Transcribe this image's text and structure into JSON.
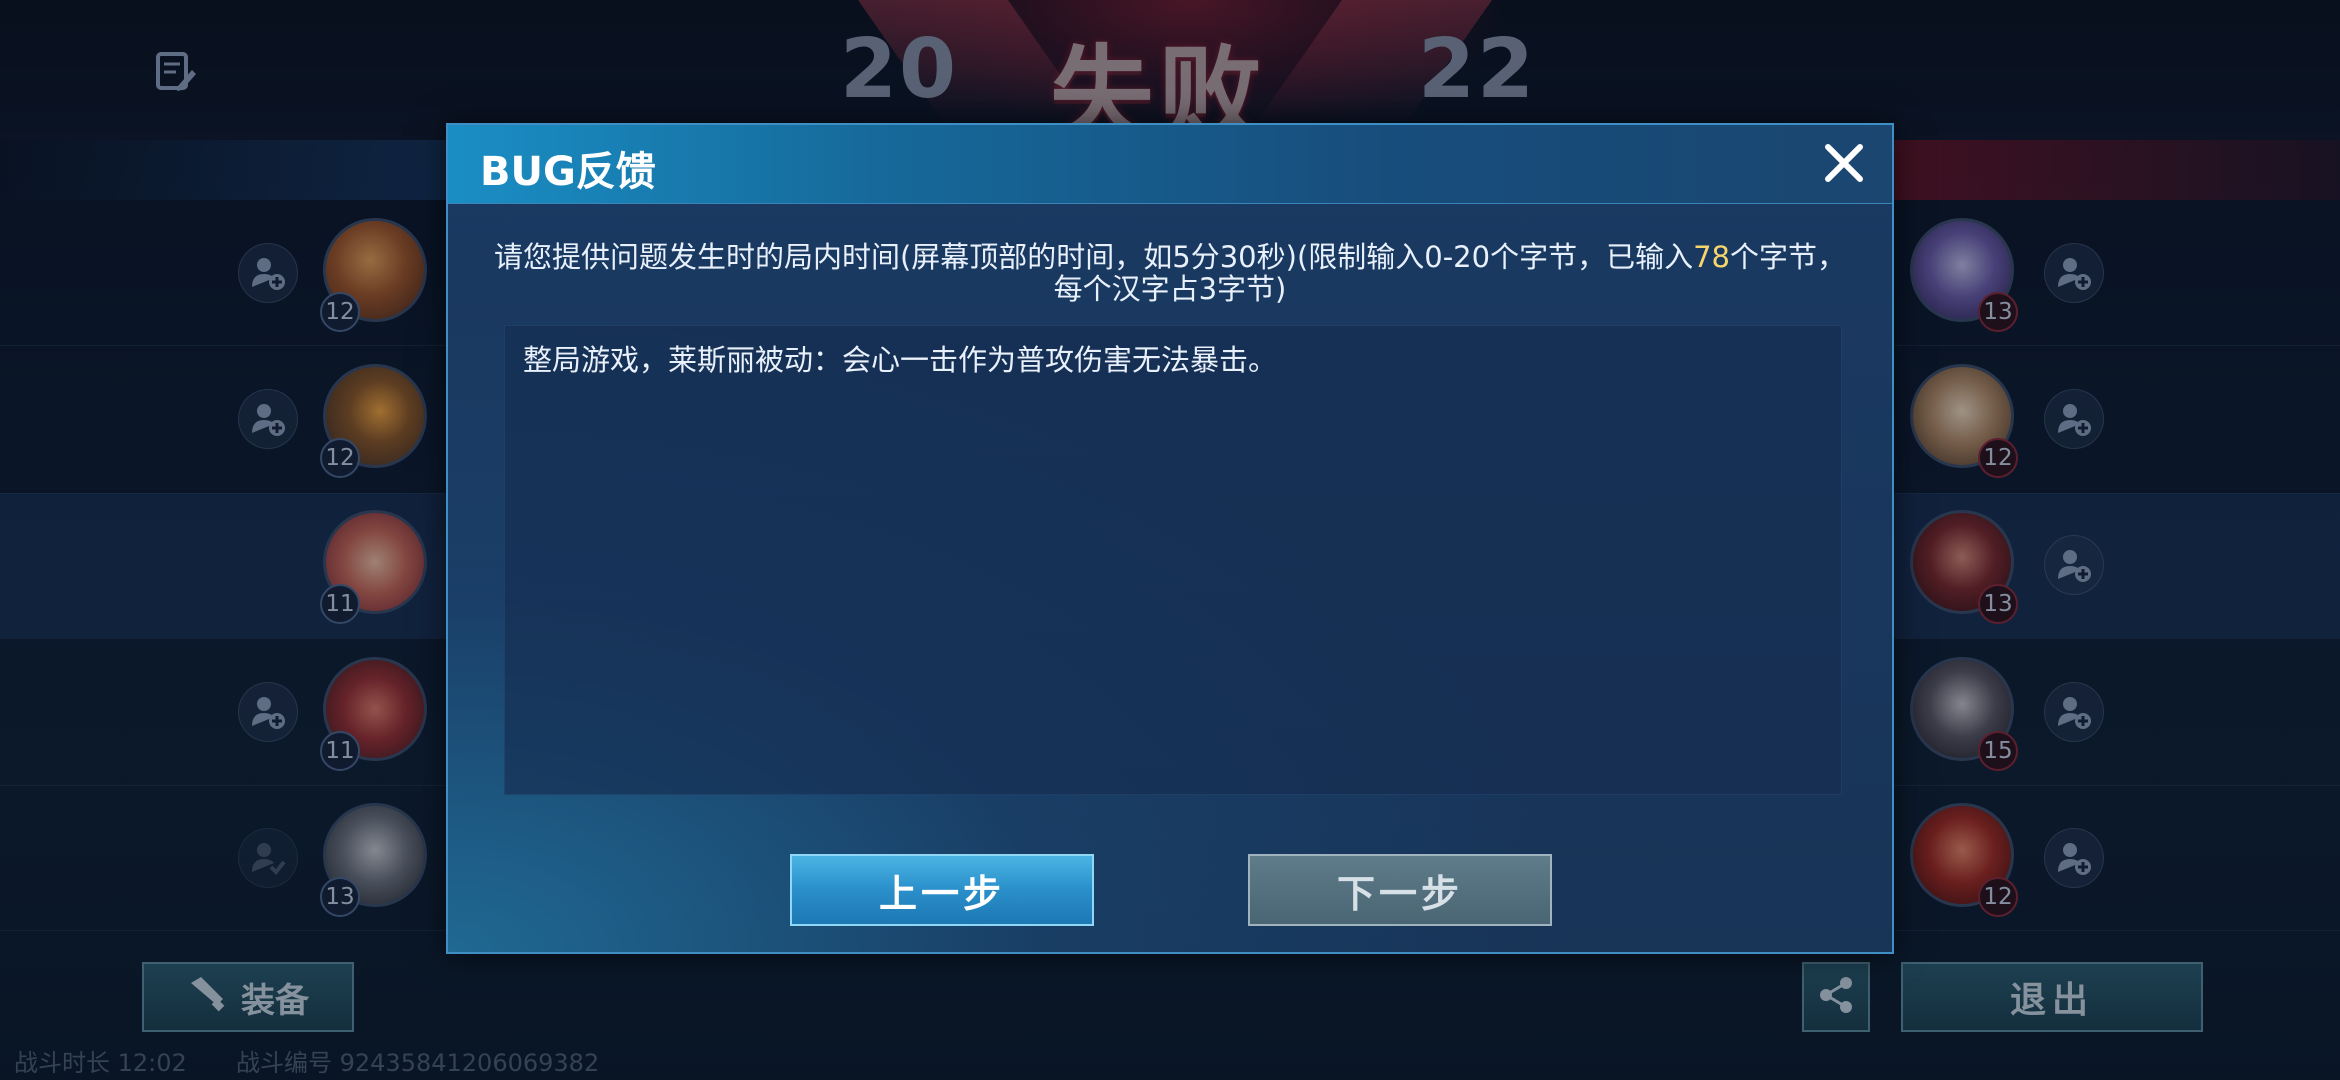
{
  "scoreboard": {
    "result_title": "失败",
    "score_left": "20",
    "score_right": "22"
  },
  "left_team": [
    {
      "hero": "hero-avatar-1",
      "level": "12"
    },
    {
      "hero": "hero-avatar-2",
      "level": "12"
    },
    {
      "hero": "hero-avatar-3",
      "level": "11"
    },
    {
      "hero": "hero-avatar-4",
      "level": "11"
    },
    {
      "hero": "hero-avatar-5",
      "level": "13"
    }
  ],
  "right_team": [
    {
      "hero": "hero-avatar-6",
      "level": "13"
    },
    {
      "hero": "hero-avatar-7",
      "level": "12"
    },
    {
      "hero": "hero-avatar-8",
      "level": "13"
    },
    {
      "hero": "hero-avatar-9",
      "level": "15"
    },
    {
      "hero": "hero-avatar-10",
      "level": "12"
    }
  ],
  "footer": {
    "equip_label": "装备",
    "exit_label": "退出",
    "duration": "战斗时长 12:02",
    "battle_id": "战斗编号  92435841206069382"
  },
  "dialog": {
    "title": "BUG反馈",
    "prompt_before": "请您提供问题发生时的局内时间(屏幕顶部的时间，如5分30秒)(限制输入0-20个字节，已输入",
    "prompt_count": "78",
    "prompt_after": "个字节，每个汉字占3字节)",
    "input_value": "整局游戏，莱斯丽被动：会心一击作为普攻伤害无法暴击。",
    "prev_label": "上一步",
    "next_label": "下一步"
  },
  "colors": {
    "accent_blue": "#2a8fca",
    "count_highlight": "#f6d66a",
    "defeat_red": "#8c2c3c"
  },
  "icons": [
    "edit-note-icon",
    "close-icon",
    "add-friend-icon",
    "friend-added-icon",
    "equipment-icon",
    "share-icon"
  ]
}
